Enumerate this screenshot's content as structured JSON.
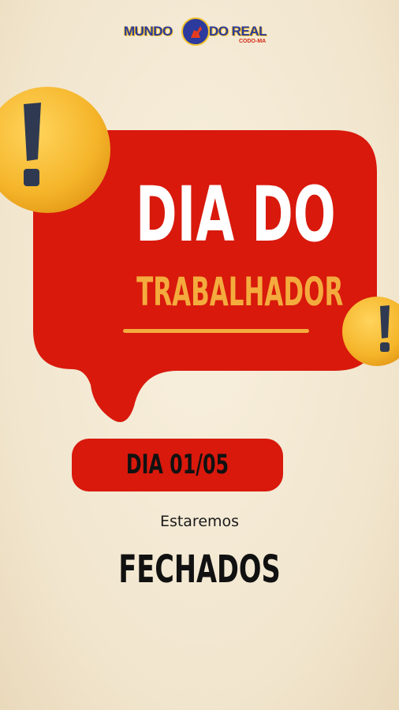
{
  "logo": {
    "left_word": "MUNDO",
    "right_word": "DO REAL",
    "subtitle": "CODO-MA"
  },
  "title": {
    "line1": "DIA DO",
    "line2": "TRABALHADOR"
  },
  "date_badge": "DIA 01/05",
  "notice": {
    "prefix": "Estaremos",
    "status": "FECHADOS"
  },
  "colors": {
    "red": "#d8190c",
    "orange": "#f4ab3d",
    "background": "#f5ebd6",
    "emoji_yellow": "#f5b52a"
  },
  "icons": [
    "exclamation-emoji-icon",
    "globe-logo-icon"
  ]
}
